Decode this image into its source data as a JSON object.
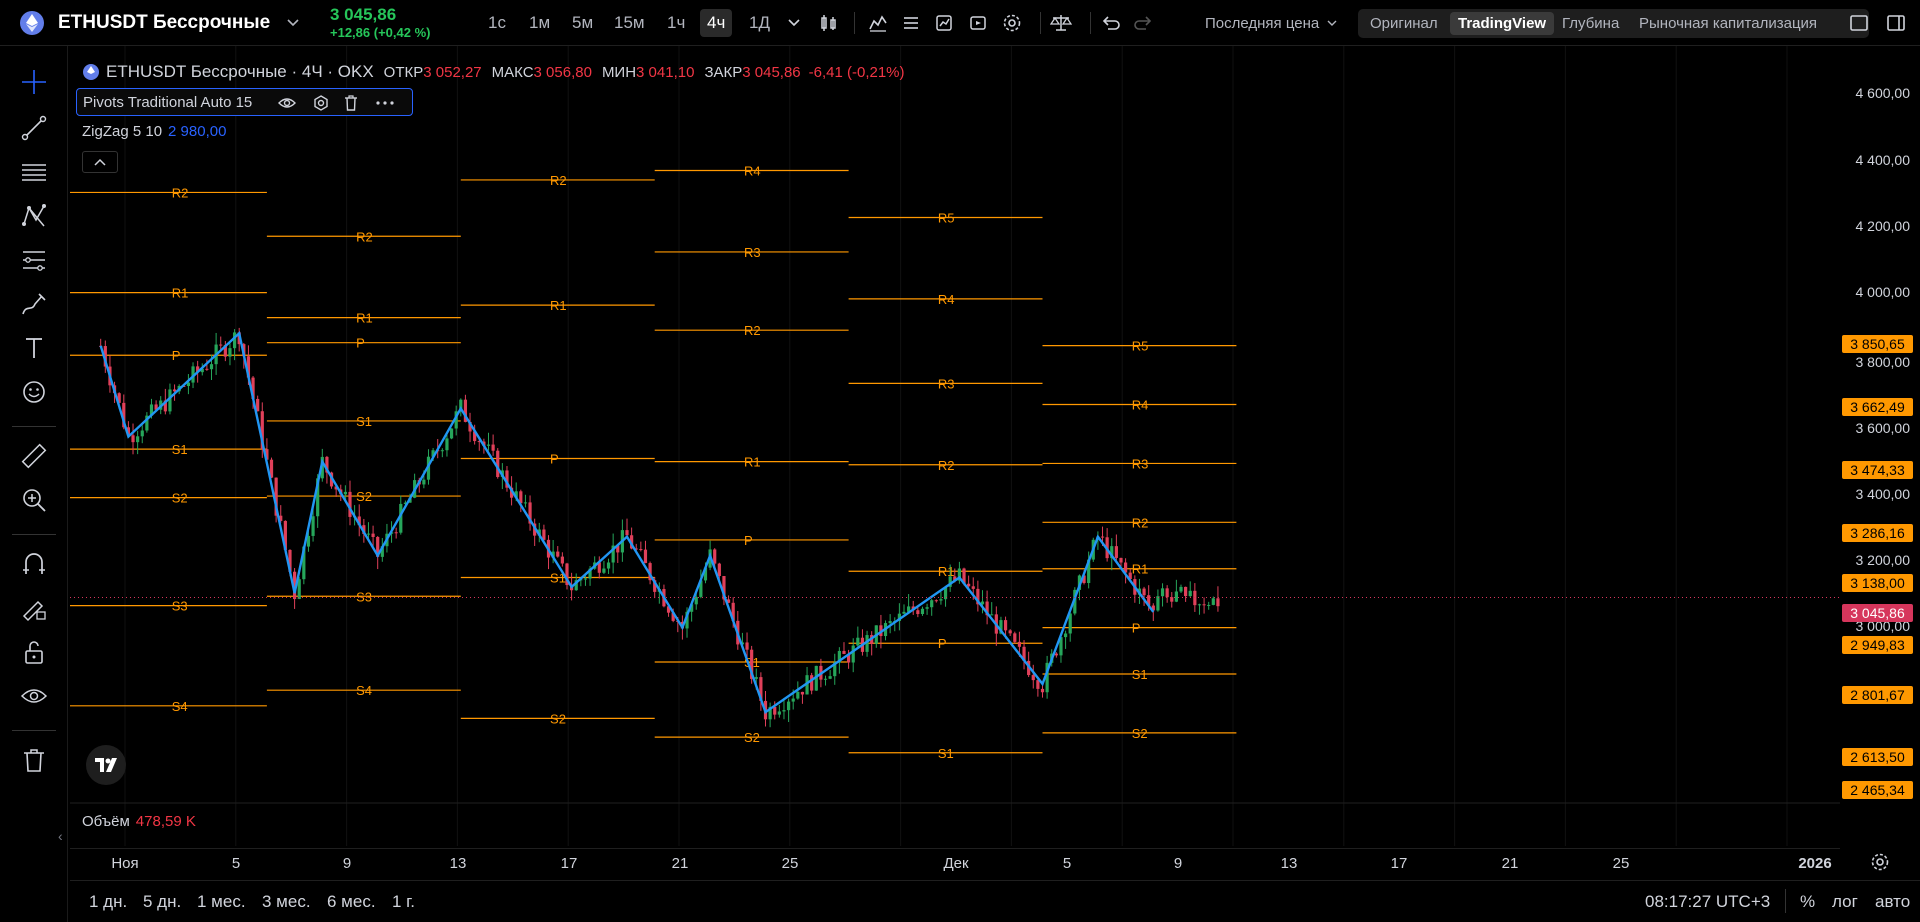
{
  "header": {
    "symbol": "ETHUSDT Бессрочные",
    "price": "3 045,86",
    "change": "+12,86 (+0,42 %)",
    "intervals": [
      "1с",
      "1м",
      "5м",
      "15м",
      "1ч",
      "4ч",
      "1Д"
    ],
    "active_interval": "4ч",
    "last_price_label": "Последняя цена",
    "view_tabs": [
      "Оригинал",
      "TradingView",
      "Глубина",
      "Рыночная капитализация"
    ],
    "active_view": "TradingView"
  },
  "legend": {
    "title": "ETHUSDT Бессрочные · 4Ч · OKX",
    "open_label": "ОТКР",
    "open": "3 052,27",
    "high_label": "МАКС",
    "high": "3 056,80",
    "low_label": "МИН",
    "low": "3 041,10",
    "close_label": "ЗАКР",
    "close": "3 045,86",
    "change": "-6,41 (-0,21%)",
    "pivots_indicator": "Pivots Traditional Auto 15",
    "zigzag_indicator": "ZigZag 5 10",
    "zigzag_value": "2 980,00",
    "collapse_icon": "^"
  },
  "price_axis": {
    "ticks": [
      "4 600,00",
      "4 400,00",
      "4 200,00",
      "4 000,00",
      "3 800,00",
      "3 600,00",
      "3 400,00",
      "3 200,00",
      "3 000,00"
    ],
    "badges": [
      {
        "label": "3 850,65",
        "color": "#ff9800"
      },
      {
        "label": "3 662,49",
        "color": "#ff9800"
      },
      {
        "label": "3 474,33",
        "color": "#ff9800"
      },
      {
        "label": "3 286,16",
        "color": "#ff9800"
      },
      {
        "label": "3 138,00",
        "color": "#ff9800"
      },
      {
        "label": "3 045,86",
        "color": "#d6365c"
      },
      {
        "label": "2 949,83",
        "color": "#ff9800"
      },
      {
        "label": "2 801,67",
        "color": "#ff9800"
      },
      {
        "label": "2 613,50",
        "color": "#ff9800"
      },
      {
        "label": "2 465,34",
        "color": "#ff9800"
      }
    ]
  },
  "volume": {
    "label": "Объём",
    "value": "478,59 K"
  },
  "time_axis": [
    "Ноя",
    "5",
    "9",
    "13",
    "17",
    "21",
    "25",
    "Дек",
    "5",
    "9",
    "13",
    "17",
    "21",
    "25",
    "2026"
  ],
  "bottom": {
    "ranges": [
      "1 дн.",
      "5 дн.",
      "1 мес.",
      "3 мес.",
      "6 мес.",
      "1 г."
    ],
    "clock": "08:17:27 UTC+3",
    "percent": "%",
    "log": "лог",
    "auto": "авто"
  },
  "chart_data": {
    "type": "candlestick",
    "symbol": "ETHUSDT",
    "interval": "4h",
    "ylim": [
      2380,
      4680
    ],
    "pivot_periods": [
      {
        "start": "Oct 26",
        "end": "Nov 3",
        "levels": {
          "R2": 4340,
          "R1": 4020,
          "P": 3820,
          "S1": 3520,
          "S2": 3365,
          "S3": 3020,
          "S4": 2700
        }
      },
      {
        "start": "Nov 3",
        "end": "Nov 10",
        "levels": {
          "R2": 4200,
          "R1": 3940,
          "P": 3860,
          "S1": 3610,
          "S2": 3370,
          "S3": 3050,
          "S4": 2750
        }
      },
      {
        "start": "Nov 10",
        "end": "Nov 17",
        "levels": {
          "R2": 4380,
          "R1": 3980,
          "P": 3490,
          "S1": 3110,
          "S2": 2660
        }
      },
      {
        "start": "Nov 17",
        "end": "Nov 24",
        "levels": {
          "R4": 4410,
          "R3": 4150,
          "R2": 3900,
          "R1": 3480,
          "P": 3230,
          "S1": 2840,
          "S2": 2600
        }
      },
      {
        "start": "Nov 24",
        "end": "Dec 1",
        "levels": {
          "R5": 4260,
          "R4": 4000,
          "R3": 3730,
          "R2": 3470,
          "R1": 3130,
          "P": 2900,
          "S1": 2550
        }
      },
      {
        "start": "Dec 1",
        "end": "Dec 8",
        "levels": {
          "R5": 3850.65,
          "R4": 3662.49,
          "R3": 3474.33,
          "R2": 3286.16,
          "R1": 3138.0,
          "P": 2949.83,
          "S1": 2801.67,
          "S2": 2613.5
        }
      }
    ],
    "zigzag": [
      {
        "x": "Oct 28",
        "y": 3850
      },
      {
        "x": "Oct 29",
        "y": 3560
      },
      {
        "x": "Nov 2",
        "y": 3890
      },
      {
        "x": "Nov 4",
        "y": 3060
      },
      {
        "x": "Nov 5",
        "y": 3480
      },
      {
        "x": "Nov 7",
        "y": 3180
      },
      {
        "x": "Nov 10",
        "y": 3650
      },
      {
        "x": "Nov 14",
        "y": 3080
      },
      {
        "x": "Nov 16",
        "y": 3240
      },
      {
        "x": "Nov 18",
        "y": 2950
      },
      {
        "x": "Nov 19",
        "y": 3180
      },
      {
        "x": "Nov 21",
        "y": 2680
      },
      {
        "x": "Nov 28",
        "y": 3110
      },
      {
        "x": "Dec 1",
        "y": 2770
      },
      {
        "x": "Dec 3",
        "y": 3240
      },
      {
        "x": "Dec 5",
        "y": 3000
      }
    ],
    "last_price": 3045.86
  }
}
